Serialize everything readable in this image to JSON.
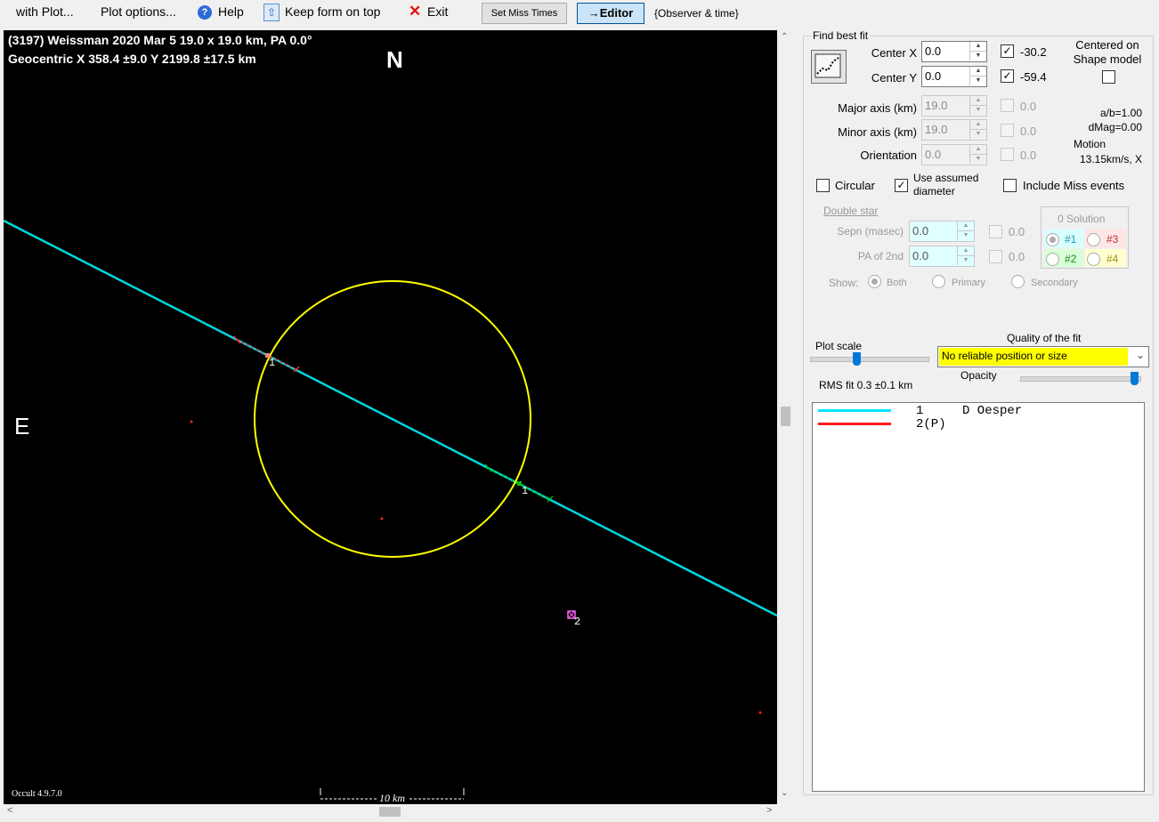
{
  "menu": {
    "with_plot": "with Plot...",
    "plot_options": "Plot options...",
    "help": "Help",
    "keep_form": "Keep form on top",
    "exit": "Exit",
    "set_miss_times": "Set Miss Times",
    "editor": "→Editor",
    "observer_time": "{Observer & time}"
  },
  "plot": {
    "title_line1": "(3197) Weissman  2020 Mar 5   19.0 x 19.0 km,  PA 0.0°",
    "title_line2": "Geocentric  X  358.4 ±9.0  Y 2199.8 ±17.5 km",
    "north": "N",
    "east": "E",
    "chord1_label_a": "1",
    "chord1_label_b": "1",
    "miss_label": "2",
    "version": "Occult 4.9.7.0",
    "scale_bar": "10 km",
    "colors": {
      "background": "#000000",
      "ellipse": "#ffff00",
      "chord": "#00d8e0",
      "miss": "#ff2020",
      "green": "#00c000"
    }
  },
  "fit": {
    "section_title": "Find best fit",
    "center_x_label": "Center X",
    "center_x_value": "0.0",
    "center_x_checked": true,
    "center_x_result": "-30.2",
    "center_y_label": "Center Y",
    "center_y_value": "0.0",
    "center_y_checked": true,
    "center_y_result": "-59.4",
    "centered_on_shape": "Centered on Shape model",
    "major_label": "Major axis (km)",
    "major_value": "19.0",
    "major_result": "0.0",
    "minor_label": "Minor axis (km)",
    "minor_value": "19.0",
    "minor_result": "0.0",
    "orient_label": "Orientation",
    "orient_value": "0.0",
    "orient_result": "0.0",
    "ab": "a/b=1.00",
    "dmag": "dMag=0.00",
    "motion_label": "Motion",
    "motion_value": "13.15km/s, X",
    "circular": "Circular",
    "use_assumed": "Use assumed diameter",
    "include_miss": "Include Miss events",
    "double_star": "Double star",
    "sepn_label": "Sepn (masec)",
    "sepn_value": "0.0",
    "sepn_result": "0.0",
    "pa2_label": "PA of 2nd",
    "pa2_value": "0.0",
    "pa2_result": "0.0",
    "solution_title": "0 Solution",
    "sol1": "#1",
    "sol2": "#2",
    "sol3": "#3",
    "sol4": "#4",
    "show_label": "Show:",
    "show_both": "Both",
    "show_primary": "Primary",
    "show_secondary": "Secondary",
    "plot_scale": "Plot scale",
    "quality_label": "Quality of the fit",
    "quality_value": "No reliable position or size",
    "opacity": "Opacity",
    "rms": "RMS fit 0.3 ±0.1 km"
  },
  "legend": [
    {
      "num": "1",
      "name": "D Oesper",
      "color": "#00e5ff"
    },
    {
      "num": "2(P)",
      "name": "",
      "color": "#ff1a1a"
    }
  ]
}
